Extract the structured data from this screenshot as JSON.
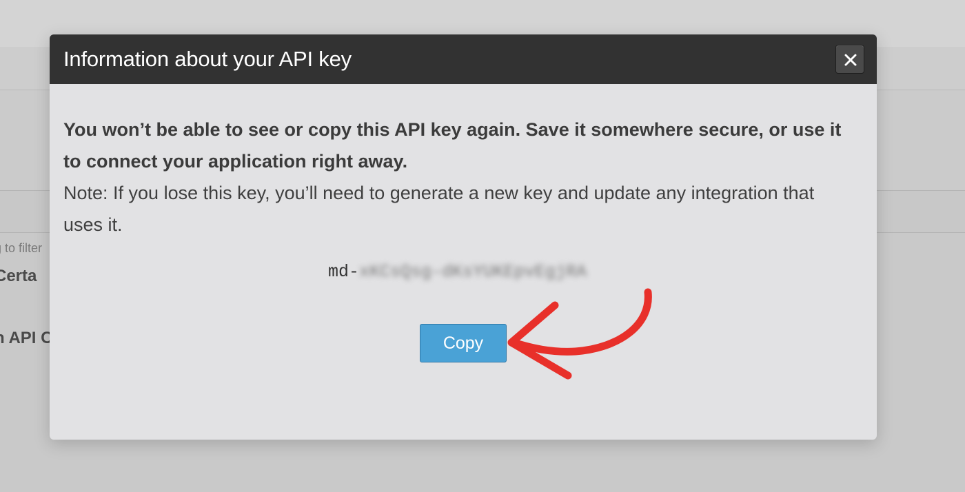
{
  "background": {
    "filter_hint": "g to filter",
    "item_1": "Certa",
    "item_2": "n API C"
  },
  "modal": {
    "title": "Information about your API key",
    "close_label": "×",
    "warning": "You won’t be able to see or copy this API key again. Save it somewhere secure, or use it to connect your application right away.",
    "note": "Note: If you lose this key, you’ll need to generate a new key and update any integration that uses it.",
    "api_key_prefix": "md-",
    "api_key_masked": "xKCsQsg-dKsYUKEpvEgjRA",
    "copy_label": "Copy"
  },
  "colors": {
    "header_bg": "#323232",
    "modal_bg": "#e2e2e4",
    "copy_button": "#4aa2d6",
    "arrow": "#e8302a"
  }
}
